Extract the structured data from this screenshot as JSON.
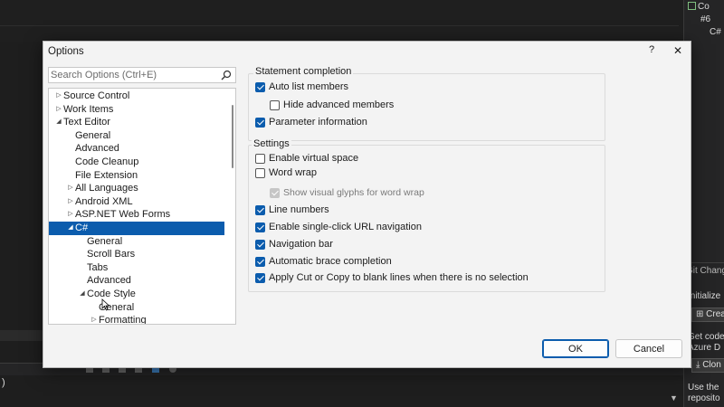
{
  "ide": {
    "right_panel": {
      "row1": "Co",
      "row2": "#6",
      "row3": "C#",
      "git_changes": "Git Changes",
      "initialize": "Initialize",
      "create_button": "Crea",
      "get_code": "Get code",
      "azure": "Azure D",
      "clone_button": "Clon",
      "use_the": "Use the",
      "repository": "reposito"
    },
    "bottom_text": ")"
  },
  "dialog": {
    "title": "Options",
    "help_label": "?",
    "close_label": "✕",
    "search": {
      "placeholder": "Search Options (Ctrl+E)"
    },
    "tree": [
      {
        "label": "Source Control",
        "depth": 0,
        "expand": "collapsed"
      },
      {
        "label": "Work Items",
        "depth": 0,
        "expand": "collapsed"
      },
      {
        "label": "Text Editor",
        "depth": 0,
        "expand": "expanded"
      },
      {
        "label": "General",
        "depth": 1,
        "expand": "none"
      },
      {
        "label": "Advanced",
        "depth": 1,
        "expand": "none"
      },
      {
        "label": "Code Cleanup",
        "depth": 1,
        "expand": "none"
      },
      {
        "label": "File Extension",
        "depth": 1,
        "expand": "none"
      },
      {
        "label": "All Languages",
        "depth": 1,
        "expand": "collapsed"
      },
      {
        "label": "Android XML",
        "depth": 1,
        "expand": "collapsed"
      },
      {
        "label": "ASP.NET Web Forms",
        "depth": 1,
        "expand": "collapsed"
      },
      {
        "label": "C#",
        "depth": 1,
        "expand": "expanded",
        "selected": true
      },
      {
        "label": "General",
        "depth": 2,
        "expand": "none"
      },
      {
        "label": "Scroll Bars",
        "depth": 2,
        "expand": "none"
      },
      {
        "label": "Tabs",
        "depth": 2,
        "expand": "none"
      },
      {
        "label": "Advanced",
        "depth": 2,
        "expand": "none"
      },
      {
        "label": "Code Style",
        "depth": 2,
        "expand": "expanded"
      },
      {
        "label": "General",
        "depth": 3,
        "expand": "none"
      },
      {
        "label": "Formatting",
        "depth": 3,
        "expand": "collapsed"
      }
    ],
    "statement_completion": {
      "title": "Statement completion",
      "auto_list_members": {
        "label": "Auto list members",
        "checked": true
      },
      "hide_advanced_members": {
        "label": "Hide advanced members",
        "checked": false
      },
      "parameter_information": {
        "label": "Parameter information",
        "checked": true
      }
    },
    "settings": {
      "title": "Settings",
      "enable_virtual_space": {
        "label": "Enable virtual space",
        "checked": false
      },
      "word_wrap": {
        "label": "Word wrap",
        "checked": false
      },
      "show_visual_glyphs": {
        "label": "Show visual glyphs for word wrap",
        "checked": true,
        "disabled": true
      },
      "line_numbers": {
        "label": "Line numbers",
        "checked": true
      },
      "single_click_url": {
        "label": "Enable single-click URL navigation",
        "checked": true
      },
      "navigation_bar": {
        "label": "Navigation bar",
        "checked": true
      },
      "automatic_brace": {
        "label": "Automatic brace completion",
        "checked": true
      },
      "apply_cut_copy": {
        "label": "Apply Cut or Copy to blank lines when there is no selection",
        "checked": true
      }
    },
    "ok_label": "OK",
    "cancel_label": "Cancel"
  },
  "colors": {
    "accent": "#0b5cad",
    "dialog_bg": "#f3f3f3",
    "ide_bg": "#1e1e1e"
  }
}
